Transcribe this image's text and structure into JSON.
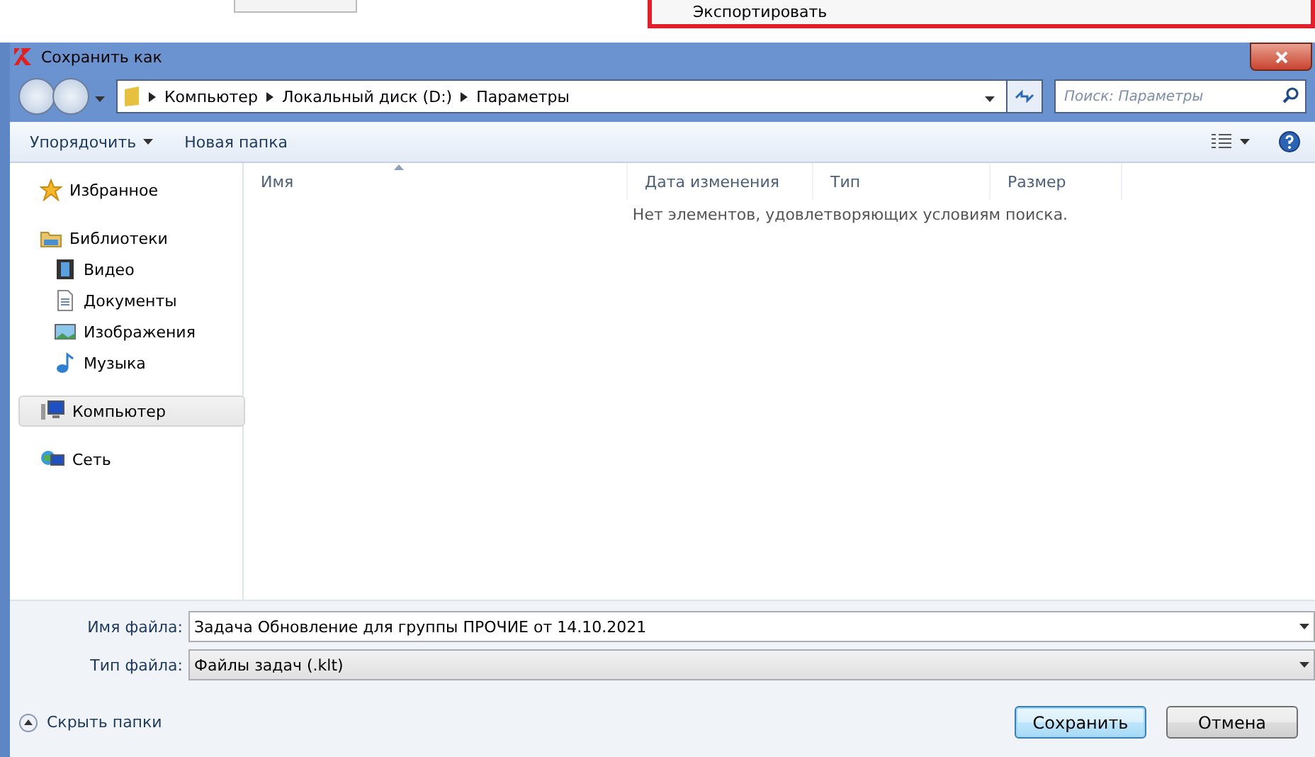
{
  "background_popup": {
    "menu_item": "Экспортировать"
  },
  "window": {
    "title": "Сохранить как"
  },
  "address_bar": {
    "path": [
      "Компьютер",
      "Локальный диск (D:)",
      "Параметры"
    ]
  },
  "search": {
    "placeholder": "Поиск: Параметры"
  },
  "toolbar": {
    "items": [
      "Упорядочить",
      "Новая папка"
    ]
  },
  "sidebar": {
    "items": [
      {
        "label": "Избранное",
        "kind": "star",
        "selected": false
      },
      {
        "label": "Библиотеки",
        "kind": "library",
        "selected": false,
        "children": [
          {
            "label": "Видео",
            "kind": "video",
            "selected": false
          },
          {
            "label": "Документы",
            "kind": "document",
            "selected": false
          },
          {
            "label": "Изображения",
            "kind": "image",
            "selected": false
          },
          {
            "label": "Музыка",
            "kind": "music",
            "selected": false
          }
        ]
      },
      {
        "label": "Компьютер",
        "kind": "computer",
        "selected": true
      },
      {
        "label": "Сеть",
        "kind": "network",
        "selected": false
      }
    ]
  },
  "file_list": {
    "columns": [
      "Имя",
      "Дата изменения",
      "Тип",
      "Размер"
    ],
    "empty_message": "Нет элементов, удовлетворяющих условиям поиска."
  },
  "file_name": {
    "label": "Имя файла:",
    "value": "Задача Обновление для группы ПРОЧИЕ от 14.10.2021"
  },
  "file_type": {
    "label": "Тип файла:",
    "value": "Файлы задач (.klt)"
  },
  "hide_folders": "Скрыть папки",
  "buttons": [
    {
      "label": "Сохранить",
      "default": true
    },
    {
      "label": "Отмена",
      "default": false
    }
  ]
}
